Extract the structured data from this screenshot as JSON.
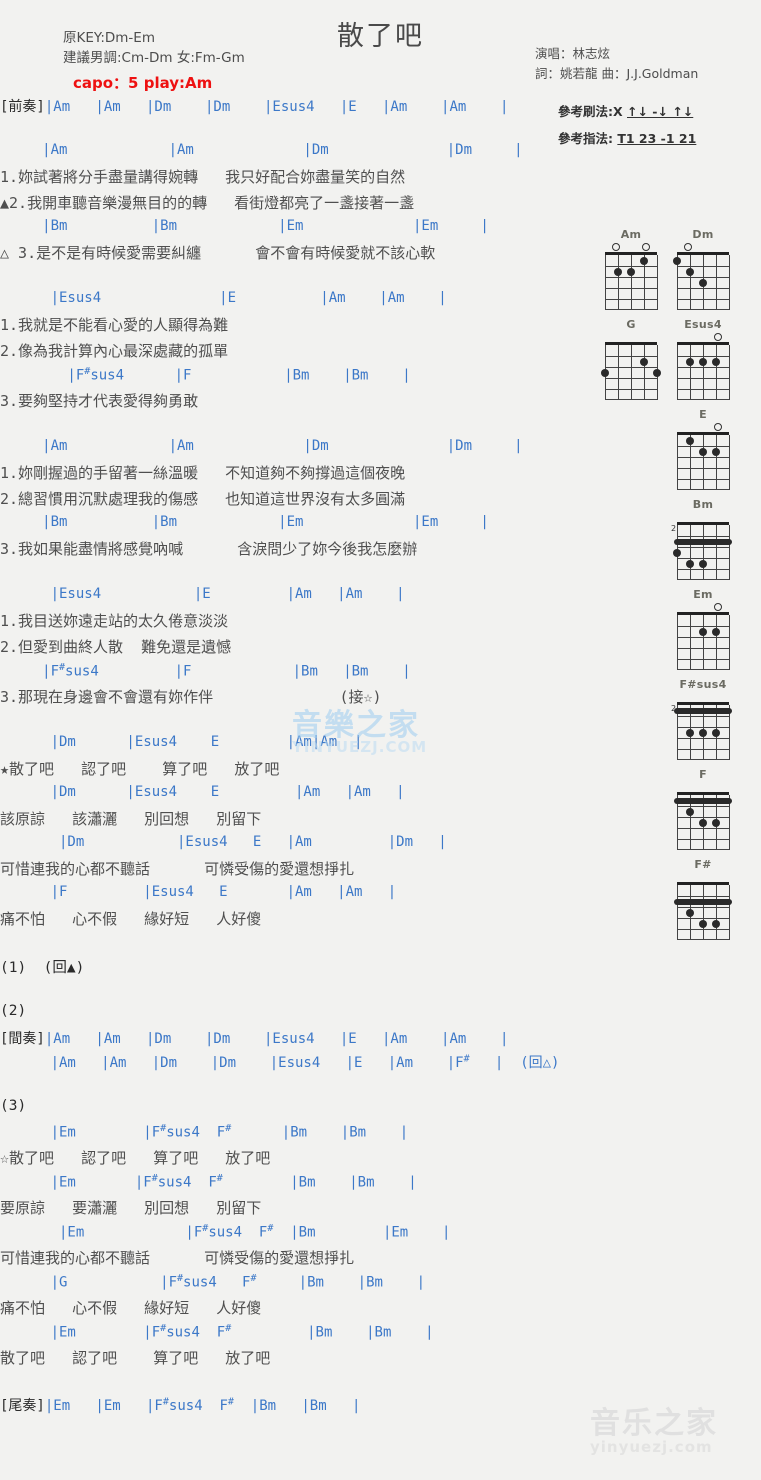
{
  "header": {
    "title": "散了吧",
    "orig_key": "原KEY:Dm-Em",
    "suggest_key": "建議男調:Cm-Dm 女:Fm-Gm",
    "capo": "capo：5 play:Am",
    "singer": "演唱：林志炫",
    "writer": "詞：姚若龍  曲：J.J.Goldman",
    "strum_label": "參考刷法:X",
    "strum_pattern": "↑↓ -↓ ↑↓",
    "fingerstyle_label": "參考指法:",
    "fingerstyle_pattern": "T1 23 -1 21"
  },
  "sections": [
    {
      "tag": "[前奏]",
      "lines": [
        {
          "type": "chords",
          "tag": "[前奏]",
          "text": "|Am   |Am   |Dm    |Dm    |Esus4   |E   |Am    |Am    |"
        }
      ]
    },
    {
      "lines": [
        {
          "type": "chords",
          "text": "     |Am            |Am             |Dm              |Dm     |"
        },
        {
          "type": "lyric",
          "text": "1.妳試著將分手盡量講得婉轉   我只好配合妳盡量笑的自然"
        },
        {
          "type": "lyric",
          "text": "▲2.我開車聽音樂漫無目的的轉   看街燈都亮了一盞接著一盞"
        },
        {
          "type": "chords",
          "text": "     |Bm          |Bm            |Em             |Em     |"
        },
        {
          "type": "lyric",
          "text": "△ 3.是不是有時候愛需要糾纏      會不會有時候愛就不該心軟"
        }
      ]
    },
    {
      "lines": [
        {
          "type": "chords",
          "text": "      |Esus4              |E          |Am    |Am    |"
        },
        {
          "type": "lyric",
          "text": "1.我就是不能看心愛的人顯得為難"
        },
        {
          "type": "lyric",
          "text": "2.像為我計算內心最深處藏的孤單"
        },
        {
          "type": "chords",
          "text": "        |F#sus4      |F           |Bm    |Bm    |"
        },
        {
          "type": "lyric",
          "text": "3.要夠堅持才代表愛得夠勇敢"
        }
      ]
    },
    {
      "lines": [
        {
          "type": "chords",
          "text": "     |Am            |Am             |Dm              |Dm     |"
        },
        {
          "type": "lyric",
          "text": "1.妳剛握過的手留著一絲溫暖   不知道夠不夠撐過這個夜晚"
        },
        {
          "type": "lyric",
          "text": "2.總習慣用沉默處理我的傷感   也知道這世界沒有太多圓滿"
        },
        {
          "type": "chords",
          "text": "     |Bm          |Bm            |Em             |Em     |"
        },
        {
          "type": "lyric",
          "text": "3.我如果能盡情將感覺吶喊      含淚問少了妳今後我怎麼辦"
        }
      ]
    },
    {
      "lines": [
        {
          "type": "chords",
          "text": "      |Esus4           |E         |Am   |Am    |"
        },
        {
          "type": "lyric",
          "text": "1.我目送妳遠走站的太久倦意淡淡"
        },
        {
          "type": "lyric",
          "text": "2.但愛到曲終人散  難免還是遺憾"
        },
        {
          "type": "chords",
          "text": "     |F#sus4         |F            |Bm   |Bm    |"
        },
        {
          "type": "lyric",
          "text": "3.那現在身邊會不會還有妳作伴              (接☆)"
        }
      ]
    },
    {
      "lines": [
        {
          "type": "chords",
          "text": "      |Dm      |Esus4    E        |Am|Am  |"
        },
        {
          "type": "lyric",
          "text": "★散了吧   認了吧    算了吧   放了吧"
        },
        {
          "type": "chords",
          "text": "      |Dm      |Esus4    E         |Am   |Am   |"
        },
        {
          "type": "lyric",
          "text": "該原諒   該瀟灑   別回想   別留下"
        },
        {
          "type": "chords",
          "text": "       |Dm           |Esus4   E   |Am         |Dm   |"
        },
        {
          "type": "lyric",
          "text": "可惜連我的心都不聽話      可憐受傷的愛還想掙扎"
        },
        {
          "type": "chords",
          "text": "      |F         |Esus4   E       |Am   |Am   |"
        },
        {
          "type": "lyric",
          "text": "痛不怕   心不假   緣好短   人好傻"
        }
      ]
    },
    {
      "lines": [
        {
          "type": "plain",
          "text": "(1)  (回▲)"
        }
      ]
    },
    {
      "lines": [
        {
          "type": "plain",
          "text": "(2)"
        },
        {
          "type": "chords",
          "tag": "[間奏]",
          "text": "|Am   |Am   |Dm    |Dm    |Esus4   |E   |Am    |Am    |"
        },
        {
          "type": "chords",
          "text": "      |Am   |Am   |Dm    |Dm    |Esus4   |E   |Am    |F#   |  (回△)"
        }
      ]
    },
    {
      "lines": [
        {
          "type": "plain",
          "text": "(3)"
        },
        {
          "type": "chords",
          "text": "      |Em        |F#sus4  F#      |Bm    |Bm    |"
        },
        {
          "type": "lyric",
          "text": "☆散了吧   認了吧   算了吧   放了吧"
        },
        {
          "type": "chords",
          "text": "      |Em       |F#sus4  F#        |Bm    |Bm    |"
        },
        {
          "type": "lyric",
          "text": "要原諒   要瀟灑   別回想   別留下"
        },
        {
          "type": "chords",
          "text": "       |Em            |F#sus4  F#  |Bm        |Em    |"
        },
        {
          "type": "lyric",
          "text": "可惜連我的心都不聽話      可憐受傷的愛還想掙扎"
        },
        {
          "type": "chords",
          "text": "      |G           |F#sus4   F#     |Bm    |Bm    |"
        },
        {
          "type": "lyric",
          "text": "痛不怕   心不假   緣好短   人好傻"
        },
        {
          "type": "chords",
          "text": "      |Em        |F#sus4  F#         |Bm    |Bm    |"
        },
        {
          "type": "lyric",
          "text": "散了吧   認了吧    算了吧   放了吧"
        }
      ]
    },
    {
      "lines": [
        {
          "type": "chords",
          "tag": "[尾奏]",
          "text": "|Em   |Em   |F#sus4  F#  |Bm   |Bm   |"
        }
      ]
    }
  ],
  "chord_diagrams": [
    {
      "name": "Am",
      "col": 0,
      "row": 0,
      "open": [
        1,
        4
      ],
      "dots": [
        {
          "s": 1,
          "f": 2
        },
        {
          "s": 2,
          "f": 2
        },
        {
          "s": 3,
          "f": 1
        }
      ],
      "barre": null,
      "fret_label": ""
    },
    {
      "name": "Dm",
      "col": 1,
      "row": 0,
      "open": [
        1
      ],
      "dots": [
        {
          "s": 0,
          "f": 1
        },
        {
          "s": 1,
          "f": 2
        },
        {
          "s": 2,
          "f": 3
        }
      ],
      "barre": null,
      "fret_label": ""
    },
    {
      "name": "G",
      "col": 0,
      "row": 1,
      "open": [],
      "dots": [
        {
          "s": 0,
          "f": 3
        },
        {
          "s": 3,
          "f": 2
        },
        {
          "s": 4,
          "f": 3
        }
      ],
      "barre": null,
      "fret_label": ""
    },
    {
      "name": "Esus4",
      "col": 1,
      "row": 1,
      "open": [
        4
      ],
      "dots": [
        {
          "s": 1,
          "f": 2
        },
        {
          "s": 2,
          "f": 2
        },
        {
          "s": 3,
          "f": 2
        }
      ],
      "barre": null,
      "fret_label": ""
    },
    {
      "name": "E",
      "col": 1,
      "row": 2,
      "open": [
        4
      ],
      "dots": [
        {
          "s": 1,
          "f": 1
        },
        {
          "s": 2,
          "f": 2
        },
        {
          "s": 3,
          "f": 2
        }
      ],
      "barre": null,
      "fret_label": ""
    },
    {
      "name": "Bm",
      "col": 1,
      "row": 3,
      "open": [],
      "dots": [
        {
          "s": 1,
          "f": 4
        },
        {
          "s": 2,
          "f": 4
        },
        {
          "s": 0,
          "f": 3
        }
      ],
      "barre": 2,
      "fret_label": "2"
    },
    {
      "name": "Em",
      "col": 1,
      "row": 4,
      "open": [
        4
      ],
      "dots": [
        {
          "s": 2,
          "f": 2
        },
        {
          "s": 3,
          "f": 2
        }
      ],
      "barre": null,
      "fret_label": ""
    },
    {
      "name": "F#sus4",
      "col": 1,
      "row": 5,
      "open": [],
      "dots": [
        {
          "s": 2,
          "f": 3
        },
        {
          "s": 3,
          "f": 3
        },
        {
          "s": 1,
          "f": 3
        }
      ],
      "barre": 1,
      "fret_label": "2"
    },
    {
      "name": "F",
      "col": 1,
      "row": 6,
      "open": [],
      "dots": [
        {
          "s": 1,
          "f": 2
        },
        {
          "s": 2,
          "f": 3
        },
        {
          "s": 3,
          "f": 3
        }
      ],
      "barre": 1,
      "fret_label": ""
    },
    {
      "name": "F#",
      "col": 1,
      "row": 7,
      "open": [],
      "dots": [
        {
          "s": 1,
          "f": 3
        },
        {
          "s": 2,
          "f": 4
        },
        {
          "s": 3,
          "f": 4
        }
      ],
      "barre": 2,
      "fret_label": ""
    }
  ],
  "watermarks": [
    {
      "id": "center",
      "text": "音樂之家",
      "sub": "YINYUEZJ.COM"
    },
    {
      "id": "footer",
      "text": "音乐之家",
      "sub": "yinyuezj.com"
    }
  ]
}
